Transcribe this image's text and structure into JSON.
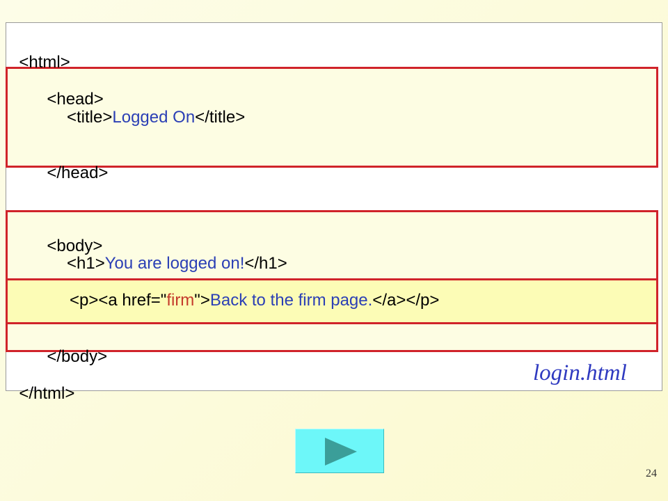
{
  "slide": {
    "filename": "login.html",
    "page_number": "24"
  },
  "code": {
    "html_open": "<html>",
    "head_open": "<head>",
    "title_open": "<title>",
    "title_text": "Logged On",
    "title_close": "</title>",
    "head_close": "</head>",
    "body_open": "<body>",
    "h1_open": "<h1>",
    "h1_text": "You are logged on!",
    "h1_close": "</h1>",
    "p_open": "<p>",
    "a_open_start": "<a href=\"",
    "a_href": "firm",
    "a_open_end": "\">",
    "a_text": "Back to the firm page.",
    "a_close": "</a>",
    "p_close": "</p>",
    "body_close": "</body>",
    "html_close": "</html>"
  },
  "colors": {
    "tag": "#000000",
    "text": "#2b3fb5",
    "attribute_value": "#c43a2b",
    "highlight_border": "#d0232a",
    "next_button": "#6df7f9"
  },
  "icons": {
    "next": "play-triangle-icon"
  }
}
